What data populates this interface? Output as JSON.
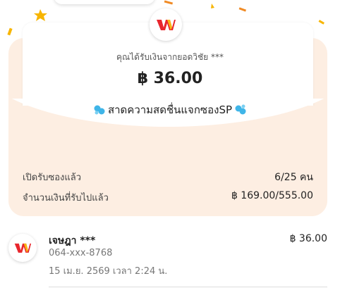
{
  "envelope": {
    "received_label": "คุณได้รับเงินจากยอดวิชัย ***",
    "amount": "฿ 36.00",
    "campaign_title": "สาดความสดชื่นแจกซองSP"
  },
  "stats": {
    "opened_label": "เปิดรับซองแล้ว",
    "opened_value": "6/25 คน",
    "total_label": "จำนวนเงินที่รับไปแล้ว",
    "total_value": "฿ 169.00/555.00"
  },
  "recipients": [
    {
      "name": "เจษฎา ***",
      "phone": "064-xxx-8768",
      "date": "15 เม.ย. 2569 เวลา 2:24 น.",
      "amount": "฿ 36.00"
    }
  ],
  "colors": {
    "envelope": "#fdeee2",
    "confetti_gold": "#f7b500",
    "confetti_orange": "#f08a24",
    "logo_red": "#e8262d",
    "logo_yellow": "#f9b512",
    "droplet_blue": "#3fb5e8"
  },
  "icons": {
    "brand_logo": "truemoney-logo-icon",
    "campaign_left": "water-splash-icon",
    "campaign_right": "water-splash-icon"
  }
}
